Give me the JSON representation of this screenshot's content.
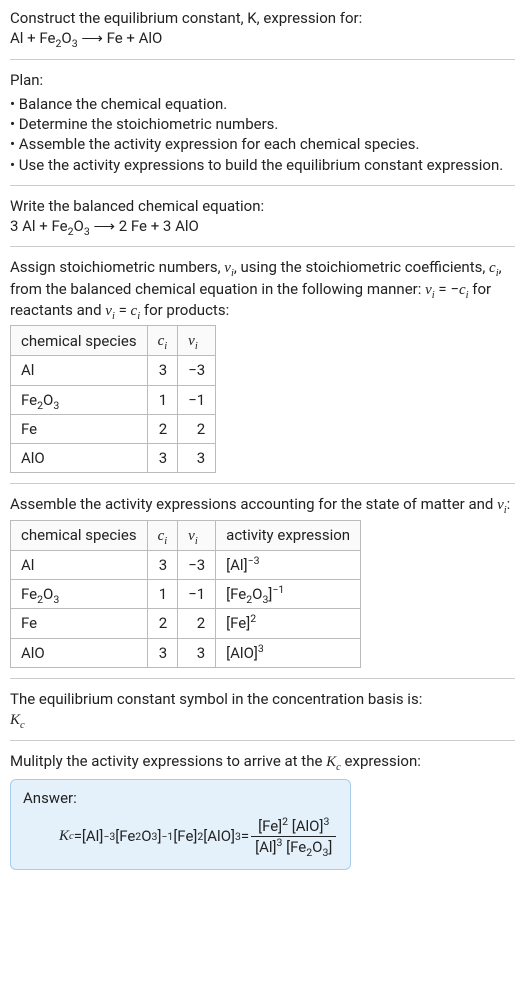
{
  "intro": {
    "line1": "Construct the equilibrium constant, K, expression for:",
    "equation_lhs": "Al + Fe",
    "equation_sub1": "2",
    "equation_mid1": "O",
    "equation_sub2": "3",
    "arrow": " ⟶ ",
    "equation_rhs": "Fe + AlO"
  },
  "plan": {
    "header": "Plan:",
    "items": [
      "Balance the chemical equation.",
      "Determine the stoichiometric numbers.",
      "Assemble the activity expression for each chemical species.",
      "Use the activity expressions to build the equilibrium constant expression."
    ]
  },
  "balanced": {
    "header": "Write the balanced chemical equation:",
    "pre1": "3 Al + Fe",
    "sub1": "2",
    "mid1": "O",
    "sub2": "3",
    "arrow": " ⟶ ",
    "post": "2 Fe + 3 AlO"
  },
  "stoich_text": {
    "p1a": "Assign stoichiometric numbers, ",
    "nu": "ν",
    "sub_i": "i",
    "p1b": ", using the stoichiometric coefficients, ",
    "c": "c",
    "p1c": ", from the balanced chemical equation in the following manner: ",
    "eq_reac": " = −",
    "p1d": " for reactants and ",
    "eq_prod": " = ",
    "p1e": " for products:"
  },
  "table1": {
    "headers": {
      "species": "chemical species",
      "ci": "c",
      "ci_sub": "i",
      "nui": "ν",
      "nui_sub": "i"
    },
    "rows": [
      {
        "species": "Al",
        "sub1": "",
        "mid": "",
        "sub2": "",
        "ci": "3",
        "nui": "−3"
      },
      {
        "species": "Fe",
        "sub1": "2",
        "mid": "O",
        "sub2": "3",
        "ci": "1",
        "nui": "−1"
      },
      {
        "species": "Fe",
        "sub1": "",
        "mid": "",
        "sub2": "",
        "ci": "2",
        "nui": "2"
      },
      {
        "species": "AlO",
        "sub1": "",
        "mid": "",
        "sub2": "",
        "ci": "3",
        "nui": "3"
      }
    ]
  },
  "assemble_header_a": "Assemble the activity expressions accounting for the state of matter and ",
  "assemble_header_b": ":",
  "table2": {
    "headers": {
      "species": "chemical species",
      "activity": "activity expression"
    },
    "rows": [
      {
        "species": "Al",
        "sub1": "",
        "mid": "",
        "sub2": "",
        "ci": "3",
        "nui": "−3",
        "act_base": "[Al]",
        "act_sub": "",
        "act_sup": "−3"
      },
      {
        "species": "Fe",
        "sub1": "2",
        "mid": "O",
        "sub2": "3",
        "ci": "1",
        "nui": "−1",
        "act_base": "[Fe",
        "act_sub": "2",
        "act_mid": "O",
        "act_sub2": "3",
        "act_close": "]",
        "act_sup": "−1"
      },
      {
        "species": "Fe",
        "sub1": "",
        "mid": "",
        "sub2": "",
        "ci": "2",
        "nui": "2",
        "act_base": "[Fe]",
        "act_sub": "",
        "act_sup": "2"
      },
      {
        "species": "AlO",
        "sub1": "",
        "mid": "",
        "sub2": "",
        "ci": "3",
        "nui": "3",
        "act_base": "[AlO]",
        "act_sub": "",
        "act_sup": "3"
      }
    ]
  },
  "kc_line": "The equilibrium constant symbol in the concentration basis is:",
  "kc_symbol": "K",
  "kc_sub": "c",
  "multiply_line_a": "Mulitply the activity expressions to arrive at the ",
  "multiply_line_b": " expression:",
  "answer": {
    "label": "Answer:",
    "lhs": "K",
    "lhs_sub": "c",
    "equals": " = ",
    "term1": "[Al]",
    "term1_sup": "−3",
    "term2a": " [Fe",
    "term2_sub1": "2",
    "term2_mid": "O",
    "term2_sub2": "3",
    "term2b": "]",
    "term2_sup": "−1",
    "term3": " [Fe]",
    "term3_sup": "2",
    "term4": " [AlO]",
    "term4_sup": "3",
    "frac": {
      "num_a": "[Fe]",
      "num_a_sup": "2",
      "num_b": " [AlO]",
      "num_b_sup": "3",
      "den_a": "[Al]",
      "den_a_sup": "3",
      "den_b_pre": " [Fe",
      "den_b_sub1": "2",
      "den_b_mid": "O",
      "den_b_sub2": "3",
      "den_b_post": "]"
    }
  },
  "chart_data": {
    "type": "table",
    "tables": [
      {
        "title": "stoichiometric numbers",
        "columns": [
          "chemical species",
          "c_i",
          "ν_i"
        ],
        "rows": [
          [
            "Al",
            3,
            -3
          ],
          [
            "Fe2O3",
            1,
            -1
          ],
          [
            "Fe",
            2,
            2
          ],
          [
            "AlO",
            3,
            3
          ]
        ]
      },
      {
        "title": "activity expressions",
        "columns": [
          "chemical species",
          "c_i",
          "ν_i",
          "activity expression"
        ],
        "rows": [
          [
            "Al",
            3,
            -3,
            "[Al]^-3"
          ],
          [
            "Fe2O3",
            1,
            -1,
            "[Fe2O3]^-1"
          ],
          [
            "Fe",
            2,
            2,
            "[Fe]^2"
          ],
          [
            "AlO",
            3,
            3,
            "[AlO]^3"
          ]
        ]
      }
    ]
  }
}
